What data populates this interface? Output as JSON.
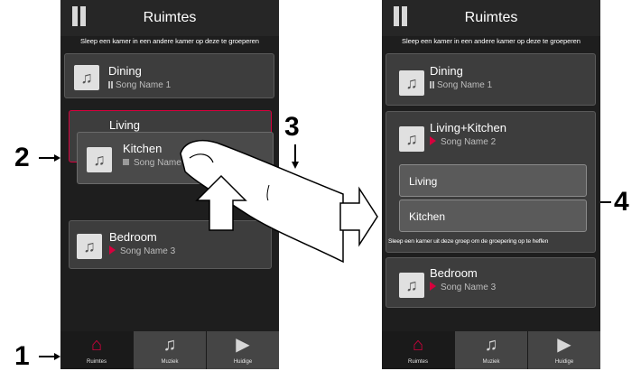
{
  "left": {
    "title": "Ruimtes",
    "hint": "Sleep een kamer in een andere kamer op deze te groeperen",
    "rooms": [
      {
        "name": "Dining",
        "song": "Song Name 1"
      },
      {
        "name": "Living"
      },
      {
        "name": "Kitchen",
        "song": "Song Name"
      },
      {
        "name": "Bedroom",
        "song": "Song Name 3"
      }
    ]
  },
  "right": {
    "title": "Ruimtes",
    "hint": "Sleep een kamer in een andere kamer op deze te groeperen",
    "rooms": [
      {
        "name": "Dining",
        "song": "Song Name 1"
      },
      {
        "name": "Living+Kitchen",
        "song": "Song Name 2"
      },
      {
        "name": "Bedroom",
        "song": "Song Name 3"
      }
    ],
    "subrooms": [
      "Living",
      "Kitchen"
    ],
    "ungroup_hint": "Sleep een kamer uit deze groep om de groepering op te heffen"
  },
  "tabs": [
    {
      "label": "Ruimtes",
      "icon": "house-icon"
    },
    {
      "label": "Muziek",
      "icon": "music-note-icon"
    },
    {
      "label": "Huidige",
      "icon": "play-icon"
    }
  ],
  "callouts": {
    "one": "1",
    "two": "2",
    "three": "3",
    "four": "4"
  },
  "colors": {
    "accent": "#d6003d",
    "background": "#1e1e1e",
    "card": "#3d3d3d"
  }
}
